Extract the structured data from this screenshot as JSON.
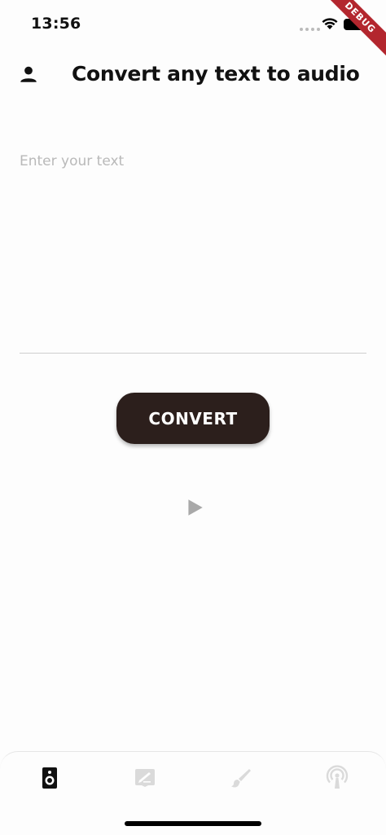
{
  "status_bar": {
    "time": "13:56"
  },
  "debug_banner": {
    "label": "DEBUG"
  },
  "app_bar": {
    "title": "Convert any text to audio"
  },
  "text_input": {
    "placeholder": "Enter your text",
    "value": ""
  },
  "convert_button": {
    "label": "CONVERT"
  },
  "bottom_nav": {
    "items": [
      {
        "icon": "speaker-icon",
        "active": true
      },
      {
        "icon": "draw-icon",
        "active": false
      },
      {
        "icon": "brush-icon",
        "active": false
      },
      {
        "icon": "podcast-icon",
        "active": false
      }
    ]
  },
  "colors": {
    "primary_button": "#2c1f1c",
    "debug_ribbon": "#b3262e",
    "inactive_icon": "#d9d9d9",
    "placeholder": "#b9b9b9"
  }
}
